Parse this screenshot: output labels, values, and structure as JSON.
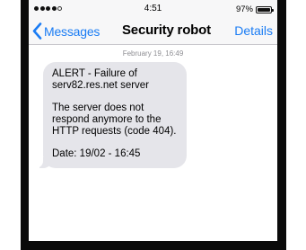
{
  "status_bar": {
    "time": "4:51",
    "battery_percent": "97%",
    "battery_level": 0.97,
    "signal_bars_filled": 4,
    "signal_bars_total": 5
  },
  "nav": {
    "back_label": "Messages",
    "title": "Security robot",
    "details_label": "Details",
    "accent_color": "#1a7cf4"
  },
  "conversation": {
    "timestamp": "February 19, 16:49",
    "message": {
      "line1": "ALERT - Failure of serv82.res.net server",
      "line2": "The server does not respond anymore to the HTTP requests (code 404).",
      "line3": "Date: 19/02 - 16:45",
      "bubble_color": "#e5e5ea"
    }
  },
  "icons": {
    "back": "chevron-left-icon",
    "battery": "battery-icon",
    "signal": "signal-dots-icon"
  }
}
